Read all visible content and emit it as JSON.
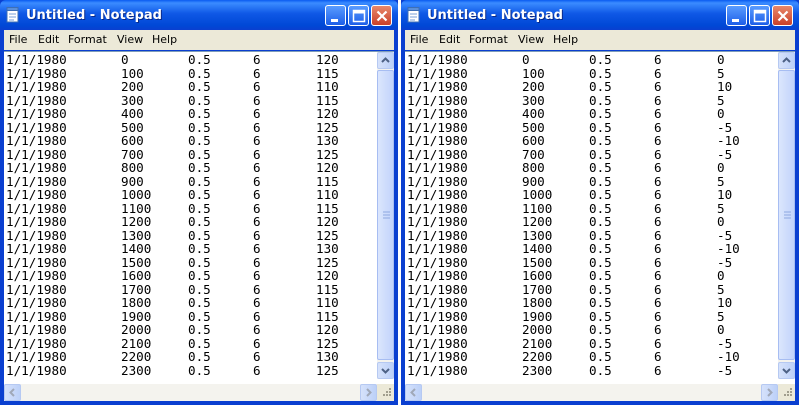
{
  "windows": [
    {
      "title": "Untitled - Notepad",
      "menu": [
        "File",
        "Edit",
        "Format",
        "View",
        "Help"
      ],
      "rows": [
        [
          "1/1/1980",
          "0",
          "0.5",
          "6",
          "120"
        ],
        [
          "1/1/1980",
          "100",
          "0.5",
          "6",
          "115"
        ],
        [
          "1/1/1980",
          "200",
          "0.5",
          "6",
          "110"
        ],
        [
          "1/1/1980",
          "300",
          "0.5",
          "6",
          "115"
        ],
        [
          "1/1/1980",
          "400",
          "0.5",
          "6",
          "120"
        ],
        [
          "1/1/1980",
          "500",
          "0.5",
          "6",
          "125"
        ],
        [
          "1/1/1980",
          "600",
          "0.5",
          "6",
          "130"
        ],
        [
          "1/1/1980",
          "700",
          "0.5",
          "6",
          "125"
        ],
        [
          "1/1/1980",
          "800",
          "0.5",
          "6",
          "120"
        ],
        [
          "1/1/1980",
          "900",
          "0.5",
          "6",
          "115"
        ],
        [
          "1/1/1980",
          "1000",
          "0.5",
          "6",
          "110"
        ],
        [
          "1/1/1980",
          "1100",
          "0.5",
          "6",
          "115"
        ],
        [
          "1/1/1980",
          "1200",
          "0.5",
          "6",
          "120"
        ],
        [
          "1/1/1980",
          "1300",
          "0.5",
          "6",
          "125"
        ],
        [
          "1/1/1980",
          "1400",
          "0.5",
          "6",
          "130"
        ],
        [
          "1/1/1980",
          "1500",
          "0.5",
          "6",
          "125"
        ],
        [
          "1/1/1980",
          "1600",
          "0.5",
          "6",
          "120"
        ],
        [
          "1/1/1980",
          "1700",
          "0.5",
          "6",
          "115"
        ],
        [
          "1/1/1980",
          "1800",
          "0.5",
          "6",
          "110"
        ],
        [
          "1/1/1980",
          "1900",
          "0.5",
          "6",
          "115"
        ],
        [
          "1/1/1980",
          "2000",
          "0.5",
          "6",
          "120"
        ],
        [
          "1/1/1980",
          "2100",
          "0.5",
          "6",
          "125"
        ],
        [
          "1/1/1980",
          "2200",
          "0.5",
          "6",
          "130"
        ],
        [
          "1/1/1980",
          "2300",
          "0.5",
          "6",
          "125"
        ]
      ]
    },
    {
      "title": "Untitled - Notepad",
      "menu": [
        "File",
        "Edit",
        "Format",
        "View",
        "Help"
      ],
      "rows": [
        [
          "1/1/1980",
          "0",
          "0.5",
          "6",
          "0"
        ],
        [
          "1/1/1980",
          "100",
          "0.5",
          "6",
          "5"
        ],
        [
          "1/1/1980",
          "200",
          "0.5",
          "6",
          "10"
        ],
        [
          "1/1/1980",
          "300",
          "0.5",
          "6",
          "5"
        ],
        [
          "1/1/1980",
          "400",
          "0.5",
          "6",
          "0"
        ],
        [
          "1/1/1980",
          "500",
          "0.5",
          "6",
          "-5"
        ],
        [
          "1/1/1980",
          "600",
          "0.5",
          "6",
          "-10"
        ],
        [
          "1/1/1980",
          "700",
          "0.5",
          "6",
          "-5"
        ],
        [
          "1/1/1980",
          "800",
          "0.5",
          "6",
          "0"
        ],
        [
          "1/1/1980",
          "900",
          "0.5",
          "6",
          "5"
        ],
        [
          "1/1/1980",
          "1000",
          "0.5",
          "6",
          "10"
        ],
        [
          "1/1/1980",
          "1100",
          "0.5",
          "6",
          "5"
        ],
        [
          "1/1/1980",
          "1200",
          "0.5",
          "6",
          "0"
        ],
        [
          "1/1/1980",
          "1300",
          "0.5",
          "6",
          "-5"
        ],
        [
          "1/1/1980",
          "1400",
          "0.5",
          "6",
          "-10"
        ],
        [
          "1/1/1980",
          "1500",
          "0.5",
          "6",
          "-5"
        ],
        [
          "1/1/1980",
          "1600",
          "0.5",
          "6",
          "0"
        ],
        [
          "1/1/1980",
          "1700",
          "0.5",
          "6",
          "5"
        ],
        [
          "1/1/1980",
          "1800",
          "0.5",
          "6",
          "10"
        ],
        [
          "1/1/1980",
          "1900",
          "0.5",
          "6",
          "5"
        ],
        [
          "1/1/1980",
          "2000",
          "0.5",
          "6",
          "0"
        ],
        [
          "1/1/1980",
          "2100",
          "0.5",
          "6",
          "-5"
        ],
        [
          "1/1/1980",
          "2200",
          "0.5",
          "6",
          "-10"
        ],
        [
          "1/1/1980",
          "2300",
          "0.5",
          "6",
          "-5"
        ]
      ]
    }
  ],
  "icons": {
    "app": "notepad-icon",
    "minimize": "minimize-icon",
    "maximize": "maximize-icon",
    "close": "close-icon",
    "scroll_up": "scroll-up-arrow-icon",
    "scroll_down": "scroll-down-arrow-icon",
    "scroll_left": "scroll-left-arrow-icon",
    "scroll_right": "scroll-right-arrow-icon",
    "resize_grip": "resize-grip-icon"
  },
  "colors": {
    "titlebar": "#0a58e6",
    "window_frame": "#0a3fd0",
    "menubar": "#ece9d8",
    "editor_bg": "#ffffff",
    "close_button": "#c9402a"
  }
}
